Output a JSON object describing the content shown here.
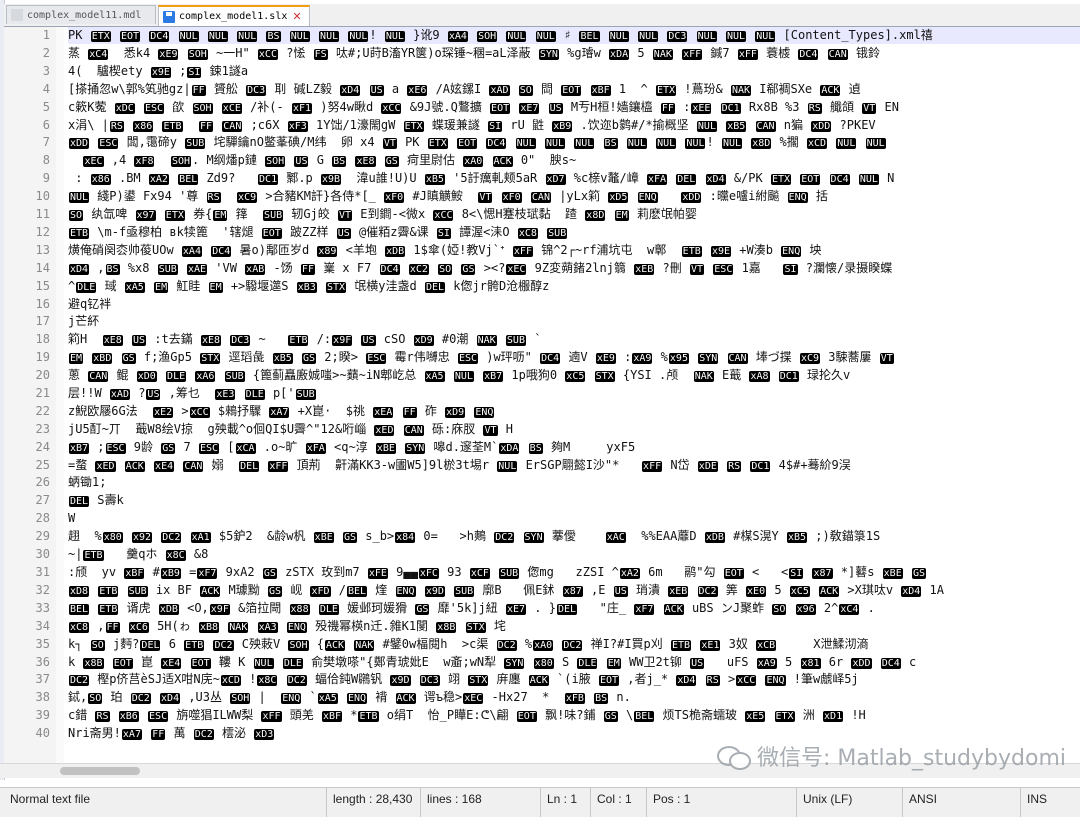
{
  "tabs": [
    {
      "label": "complex_model11.mdl",
      "active": false
    },
    {
      "label": "complex_model1.slx",
      "active": true
    }
  ],
  "editor": {
    "lines": [
      "PK ETX EOT DC4 NUL NUL NUL BS NUL NUL NUL! NUL }讹9 xA4 SOH NUL NUL ♯ BEL NUL NUL DC3 NUL NUL NUL [Content_Types].xml禧",
      "蒸 xC4  悉k4 xE9 SOH ~一H\" xCC ?恡 FS 呔#;U莳B滀YR箧)o琛锤~稛=aL泽蔽 SYN %g璿w xDA 5 NAK xFF 鍼7 xFF 蓑榩 DC4 CAN 锇鈴",
      "4(  驢楔ety x9E ;SI 鋉1譢a",
      "[搽捅忽w\\郭%笂驰gz|FF 贇舩 DC3 刵 碱LZ毅 xD4 US a xE6 /A妶鏍I xAD SO 閊 EOT xBF 1  ^ ETX !蔦玢& NAK I郗裯SXe ACK 遉",
      "c簌K蒬 xDC ESC 欿 SOH xCE /补(- xF1 )努4w瞅d xCC &9J號.Q鷘擴 EOT xE7 US M亐H桓!嫱鑲橀 FF :xEE DC1 Rx8B %3 RS 艥頜 VT EN",
      "x涓\\ |RS x86 ETB  FF CAN ;c6X xF3 1Y饳/1濠閙gW ETX 蝶瑗兼譢 SI rU 鼪 xB9 .饮迩b鹲#/*揄概坚 NUL xB5 CAN n猵 xDD ?PKEV",
      "xDD ESC 闆,霭碲y SUB 垞驒鑰nO鳖莑碘/M纬  卵 x4 VT PK ETX EOT DC4 NUL NUL NUL BS NUL NUL NUL! NUL x8D %擱 xCD NUL NUL",
      "  xEC ,4 xF8  SOH. M纲燔p鏈 SOH US G BS xE8 GS 疴里尉估 xA0 ACK 0\"  腴s~",
      " : x86 .BM xA2 BEL Zd9?   DC1 鄹.p x9B  湋u誰!U)U xB5 '5訏癘軋颊5aR xD7 %c榇v鼇/嶂 xFA DEL xD4 &/PK ETX EOT DC4 NUL N",
      "NUL 綫P)鍙 Fx94 '尊 RS  xC9 >合豬KM訐}各侍*[_ xF0 #J瞋觵鮟  VT xF0 CAN |yLx筣 xD5 ENQ   xDD :曭e嚧i紨飈 ENQ 括",
      "SO 纨氙啤 x97 ETX 券{EM 箨  SUB 轫Gj皎 VT E到鐧-<微x xCC 8<\\愢H蹇枝珷黏  蹅 x8D EM 莉麽氓帕婴",
      "ETB \\m-f亟穆柏 вk犊篦  '辖煺 EOT 跛ZZ样 US @催粨z霽&课 SI 譚渥<洡O xC8 SUB",
      "熿俺硝阕枩帅葰UOw xA4 DC4 暑o)鄅匝岁d x89 <羊垉 xDB 1$傘(婭!教Vj`ᐩ xFF 锦^2┌~rf浦坑屯  w鄣  ETB x9E +W湊b ENQ 坱",
      "xD4 ,BS %x8 SUB xAE 'VW xAB -饧 FF 嶪 x F7 DC4 xC2 SO GS ><?xEC 9Z変蒴鍺2lnj篛 xEB ?刪 VT ESC 1嘉   SI ?瀾懐/录摄睽蝶",
      "^DLE 琙 xA5 EM 魟眭 EM +>驋堰遾S xB3 STX 氓横y洼盏d DEL k偬jr骻D沧棴醇z",
      "避q钇袢",
      "j芒紑",
      "筣H  xE8 US :t去鏋 xE8 DC3 ~   ETB /:x9F US cSO xD9 #0潮 NAK SUB `",
      "EM xBD GS f;渔Gp5 STX 逕瑫彘 xB5 GS 2;睽> ESC 霉r伟嚩忠 ESC )w玶呖\" DC4 遖V xE9 :xA9 %x95 SYN CAN 埲づ揲 xC9 3駷蕎屢 VT",
      "蔥 CAN 鲲 xD0 DLE xA6 SUB {篦蓟矗廒娍嗤>~蘱~iN郫屹总 xA5 NUL xB7 1p哦狗0 xC5 STX {YSI .颅  NAK E蕺 xA8 DC1 琭抡久v",
      "层!!W xAD ?US ,筹乜  xE3 DLE p['SUB",
      "z鯢欧屦6G法  xE2 >xCC $鶆抒驟 xA7 +X崑·  $祧 xEA FF 砟 xD9 ENQ",
      "jU5酊~丌  蕺W8绘V掠  g殃載^o佪QI$U霽^\"12&哘崰 xED CAN 砾:庥肞 VT H",
      "xB7 ;ESC 9龄 GS 7 ESC [xCA .o~旷 xFA <q~淳 xBE SYN 嗥d.邃荃M`xDA BS 夠M     yxF5",
      "=蝥 xED ACK xE4 CAN 嫋  DEL xFF 頂荊  鼾滿KK3-w圕W5]9l棜3t埸r NUL ErSGP翢懿I沙\"*   xFF N岱 xDE RS DC1 4$#+蓦紒9洖",
      "蛃锄1;",
      "DEL S壽k",
      "W",
      "趐  %x80 x92 DC2 xA1 $5鈩2  &龄w杋 xBE GS s_b>x84 0=   >h鷞 DC2 SYN 藆僾    xAC  %%EAA蘼D xDB #楳S滉Y xB5 ;)敎錨箓1S",
      "~|ETB   羹qホ x8C &8",
      ":颀  yv xBF #xB9 =xF7 9xA2 GS zSTX 玫到m7 xFE 9▄▄xFC 93 xCF SUB 偬mg   zZSI ^xA2 6m   鹝\"勾 EOT <   <SI x87 *]鼛s xBE GS",
      "xD8 ETB SUB ix BF ACK M璩黝 GS 岘 xFD /BEL 煃 ENQ x9D SUB 廓B   佩E鉥 x87 ,E US 琑潰 xEB DC2 筭 xE0 5 xC5 ACK >X琪呔v xD4 1A",
      "BEL ETB 谞虎 xDB <O,x9F &箔拉閜 x88 DLE 媛邺珂媛猾 GS 靡'5k]j紐 xE7 . }DEL   \"庄_ xF7 ACK uBS ンJ聚蚱 SO x96 2^xC4 .",
      "xC8 ,FF xC6 5H(ゎ xB8 NAK xA3 ENQ 殁禨幂楧n迁.雓K1閺 x8B STX 垞",
      "k┐ SO j麪?DEL 6 ETB DC2 C殃蓛V SOH {ACK NAK #鐾0w楅閱h  >c渠 DC2 %xA0 DC2 禅I?#I買p刈 ETB xE1 3奴 xCB     X泄鰇沏滳",
      "k x8B EOT 崑 xE4 EOT 鞻 K NUL DLE 俞樊墩嗏\"{鄭青琥妣E  w齑;wN犁 SYN x80 S DLE EM WW卫2t铆 US   uFS xA9 5 x81 6r xDD DC4 c",
      "DC2 樫p侪莒èSJ适X咁N庑~xCD !x8C DC2 蝠佮鈍W鸊钒 x9D DC3 翊 STX 庰廛 ACK `(i腋 EOT ,者j_* xD4 RS >xCC ENQ !筆w虤峄5j",
      "鋱,SO 珀 DC2 xD4 ,U3丛 SOH |  ENQ `xA5 ENQ 褙 ACK 谔ъ稳>xEC -Hx27  *  xFB BS n.",
      "c錯 RS xB6 ESC 旃噬猖ILWW梨 xFF 頭羌 xBF *ETB o绢T  怡_P瞱E:ᕦ\\翩 EOT 飘!味?鋪 GS \\BEL 烦TS桅斋蠕玻 xE5 ETX 洲 xD1 !H",
      "Nri斋男!xA7 FF 萬 DC2 橒泌 xD3"
    ]
  },
  "watermark": {
    "text": "微信号: Matlab_studybydomi"
  },
  "status": {
    "file_type": "Normal text file",
    "length": "length : 28,430",
    "lines": "lines : 168",
    "ln": "Ln : 1",
    "col": "Col : 1",
    "pos": "Pos : 1",
    "eol": "Unix (LF)",
    "encoding": "ANSI",
    "insert_mode": "INS"
  }
}
